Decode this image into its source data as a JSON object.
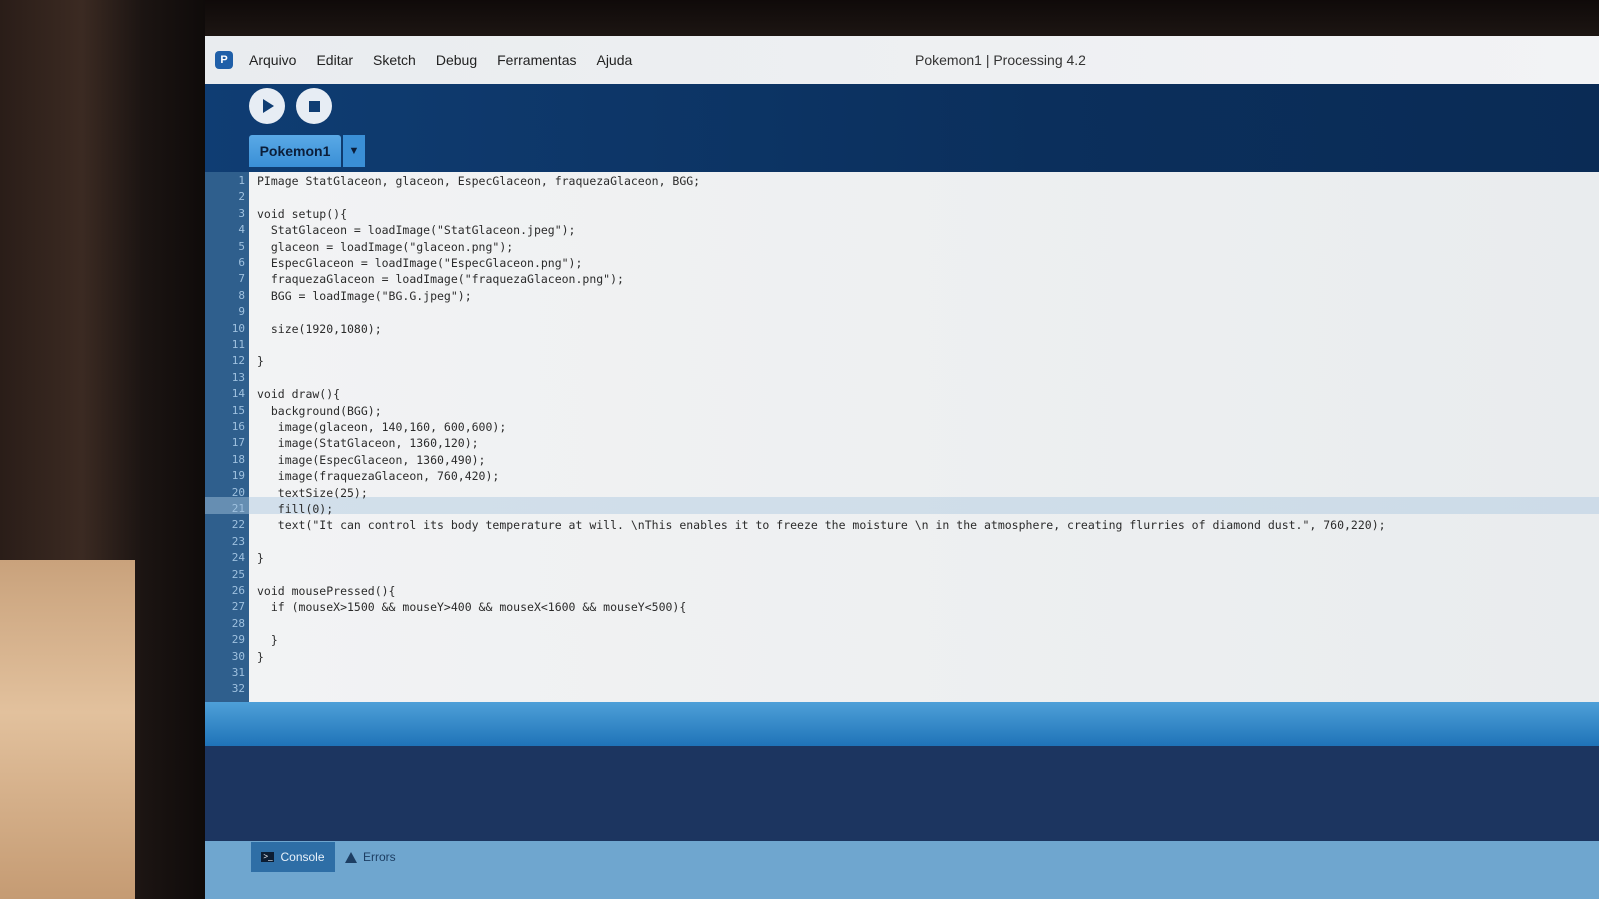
{
  "window": {
    "title": "Pokemon1 | Processing 4.2"
  },
  "menu": {
    "items": [
      "Arquivo",
      "Editar",
      "Sketch",
      "Debug",
      "Ferramentas",
      "Ajuda"
    ]
  },
  "tabs": {
    "active": "Pokemon1"
  },
  "editor": {
    "line_numbers": [
      "1",
      "2",
      "3",
      "4",
      "5",
      "6",
      "7",
      "8",
      "9",
      "10",
      "11",
      "12",
      "13",
      "14",
      "15",
      "16",
      "17",
      "18",
      "19",
      "20",
      "21",
      "22",
      "23",
      "24",
      "25",
      "26",
      "27",
      "28",
      "29",
      "30",
      "31",
      "32"
    ],
    "current_line": 21,
    "lines": [
      "PImage StatGlaceon, glaceon, EspecGlaceon, fraquezaGlaceon, BGG;",
      "",
      "void setup(){",
      "  StatGlaceon = loadImage(\"StatGlaceon.jpeg\");",
      "  glaceon = loadImage(\"glaceon.png\");",
      "  EspecGlaceon = loadImage(\"EspecGlaceon.png\");",
      "  fraquezaGlaceon = loadImage(\"fraquezaGlaceon.png\");",
      "  BGG = loadImage(\"BG.G.jpeg\");",
      "",
      "  size(1920,1080);",
      "",
      "}",
      "",
      "void draw(){",
      "  background(BGG);",
      "   image(glaceon, 140,160, 600,600);",
      "   image(StatGlaceon, 1360,120);",
      "   image(EspecGlaceon, 1360,490);",
      "   image(fraquezaGlaceon, 760,420);",
      "   textSize(25);",
      "   fill(0);",
      "   text(\"It can control its body temperature at will. \\nThis enables it to freeze the moisture \\n in the atmosphere, creating flurries of diamond dust.\", 760,220);",
      "",
      "}",
      "",
      "void mousePressed(){",
      "  if (mouseX>1500 && mouseY>400 && mouseX<1600 && mouseY<500){",
      "",
      "  }",
      "}"
    ]
  },
  "console": {
    "console_tab": "Console",
    "errors_tab": "Errors"
  },
  "colors": {
    "menubar": "#eef0f2",
    "toolbar": "#0f3d73",
    "tab": "#4a9ee0",
    "editor_bg": "#eef0f2",
    "gutter": "#2f5f8d"
  }
}
